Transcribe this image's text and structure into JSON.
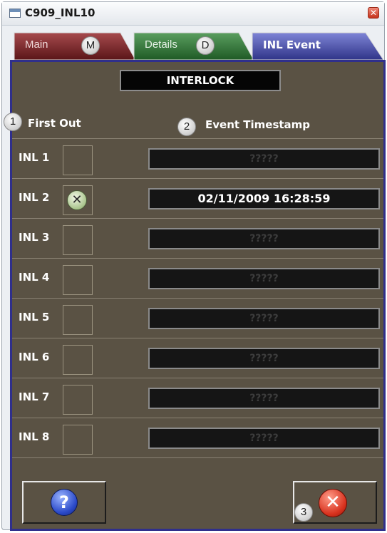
{
  "window": {
    "title": "C909_INL10",
    "close_symbol": "✕"
  },
  "tabs": [
    {
      "label": "Main",
      "callout": "M",
      "color": "#6e1f22"
    },
    {
      "label": "Details",
      "callout": "D",
      "color": "#2d6b33"
    },
    {
      "label": "INL Event",
      "color": "#3a3f9a"
    }
  ],
  "panel": {
    "title": "INTERLOCK",
    "first_out_header": "First Out",
    "timestamp_header": "Event Timestamp",
    "callouts": {
      "first_out": "1",
      "timestamp": "2",
      "close": "3"
    }
  },
  "rows": [
    {
      "label": "INL 1",
      "first_out": false,
      "timestamp": "?????"
    },
    {
      "label": "INL 2",
      "first_out": true,
      "timestamp": "02/11/2009 16:28:59"
    },
    {
      "label": "INL 3",
      "first_out": false,
      "timestamp": "?????"
    },
    {
      "label": "INL 4",
      "first_out": false,
      "timestamp": "?????"
    },
    {
      "label": "INL 5",
      "first_out": false,
      "timestamp": "?????"
    },
    {
      "label": "INL 6",
      "first_out": false,
      "timestamp": "?????"
    },
    {
      "label": "INL 7",
      "first_out": false,
      "timestamp": "?????"
    },
    {
      "label": "INL 8",
      "first_out": false,
      "timestamp": "?????"
    }
  ],
  "buttons": {
    "help": {
      "icon": "help-icon",
      "glyph": "?"
    },
    "close": {
      "icon": "close-icon",
      "glyph": "✕"
    }
  },
  "colors": {
    "panel_bg": "#5a5244",
    "panel_border": "#2f2f8c"
  }
}
